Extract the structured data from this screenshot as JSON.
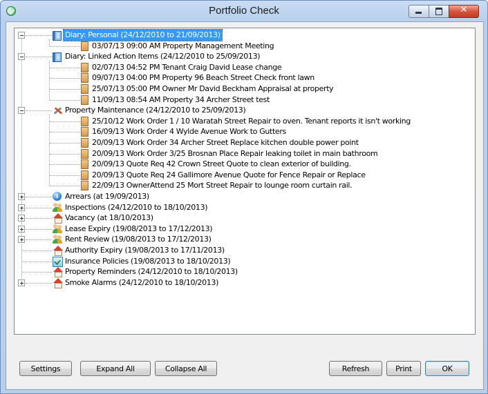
{
  "window": {
    "title": "Portfolio Check",
    "close_glyph": "✕"
  },
  "tree": {
    "rows": [
      {
        "level": 0,
        "expander": "minus",
        "icon": "diary-icon",
        "label": "Diary: Personal (24/12/2010 to 21/09/2013)",
        "selected": true
      },
      {
        "level": 1,
        "icon": "note-icon",
        "label": "03/07/13  09:00 AM  Property Management Meeting"
      },
      {
        "level": 0,
        "expander": "minus",
        "icon": "diary-icon",
        "label": "Diary: Linked Action Items (24/12/2010 to 25/09/2013)"
      },
      {
        "level": 1,
        "icon": "note-icon",
        "label": "02/07/13  04:52 PM  Tenant  Craig David Lease change"
      },
      {
        "level": 1,
        "icon": "note-icon",
        "label": "09/07/13  04:00 PM  Property  96 Beach Street Check front lawn"
      },
      {
        "level": 1,
        "icon": "note-icon",
        "label": "25/07/13  05:00 PM  Owner  Mr David Beckham Appraisal at property"
      },
      {
        "level": 1,
        "icon": "note-icon",
        "label": "11/09/13  08:54 AM  Property  34 Archer Street test"
      },
      {
        "level": 0,
        "expander": "minus",
        "icon": "tools-icon",
        "label": "Property Maintenance (24/12/2010 to 25/09/2013)"
      },
      {
        "level": 1,
        "icon": "note-icon",
        "label": "25/10/12  Work Order  1 / 10 Waratah Street  Repair to oven. Tenant reports it isn't working"
      },
      {
        "level": 1,
        "icon": "note-icon",
        "label": "16/09/13  Work Order  4 Wylde Avenue  Work to Gutters"
      },
      {
        "level": 1,
        "icon": "note-icon",
        "label": "20/09/13  Work Order  34 Archer Street  Replace kitchen double power point"
      },
      {
        "level": 1,
        "icon": "note-icon",
        "label": "20/09/13  Work Order  3/25 Brosnan Place  Repair leaking toilet in main bathroom"
      },
      {
        "level": 1,
        "icon": "note-icon",
        "label": "20/09/13  Quote Req  42 Crown Street  Quote to clean exterior of building."
      },
      {
        "level": 1,
        "icon": "note-icon",
        "label": "20/09/13  Quote Req  24 Gallimore Avenue  Quote for Fence Repair or Replace"
      },
      {
        "level": 1,
        "icon": "note-icon",
        "label": "22/09/13  OwnerAttend  25 Mort Street  Repair to lounge room curtain rail."
      },
      {
        "level": 0,
        "expander": "plus",
        "icon": "info-icon",
        "label": "Arrears (at 19/09/2013)"
      },
      {
        "level": 0,
        "expander": "plus",
        "icon": "people-icon",
        "label": "Inspections (24/12/2010 to 18/10/2013)"
      },
      {
        "level": 0,
        "expander": "plus",
        "icon": "house-icon",
        "label": "Vacancy (at 18/10/2013)"
      },
      {
        "level": 0,
        "expander": "plus",
        "icon": "people-icon",
        "label": "Lease Expiry (19/08/2013 to 17/12/2013)"
      },
      {
        "level": 0,
        "expander": "plus",
        "icon": "people-icon",
        "label": "Rent Review (19/08/2013 to 17/12/2013)"
      },
      {
        "level": 0,
        "expander": "none",
        "icon": "house-icon",
        "label": "Authority Expiry (19/08/2013 to 17/11/2013)"
      },
      {
        "level": 0,
        "expander": "none",
        "icon": "insurance-icon",
        "label": "Insurance Policies (19/08/2013 to 18/10/2013)"
      },
      {
        "level": 0,
        "expander": "none",
        "icon": "house-icon",
        "label": "Property Reminders (24/12/2010 to 18/10/2013)"
      },
      {
        "level": 0,
        "expander": "plus",
        "icon": "house-icon",
        "label": "Smoke Alarms (24/12/2010 to 18/10/2013)"
      }
    ]
  },
  "buttons": {
    "settings": "Settings",
    "expand_all": "Expand All",
    "collapse_all": "Collapse All",
    "refresh": "Refresh",
    "print": "Print",
    "ok": "OK"
  },
  "colors": {
    "selection": "#3399ff",
    "close_button": "#c33c22"
  }
}
